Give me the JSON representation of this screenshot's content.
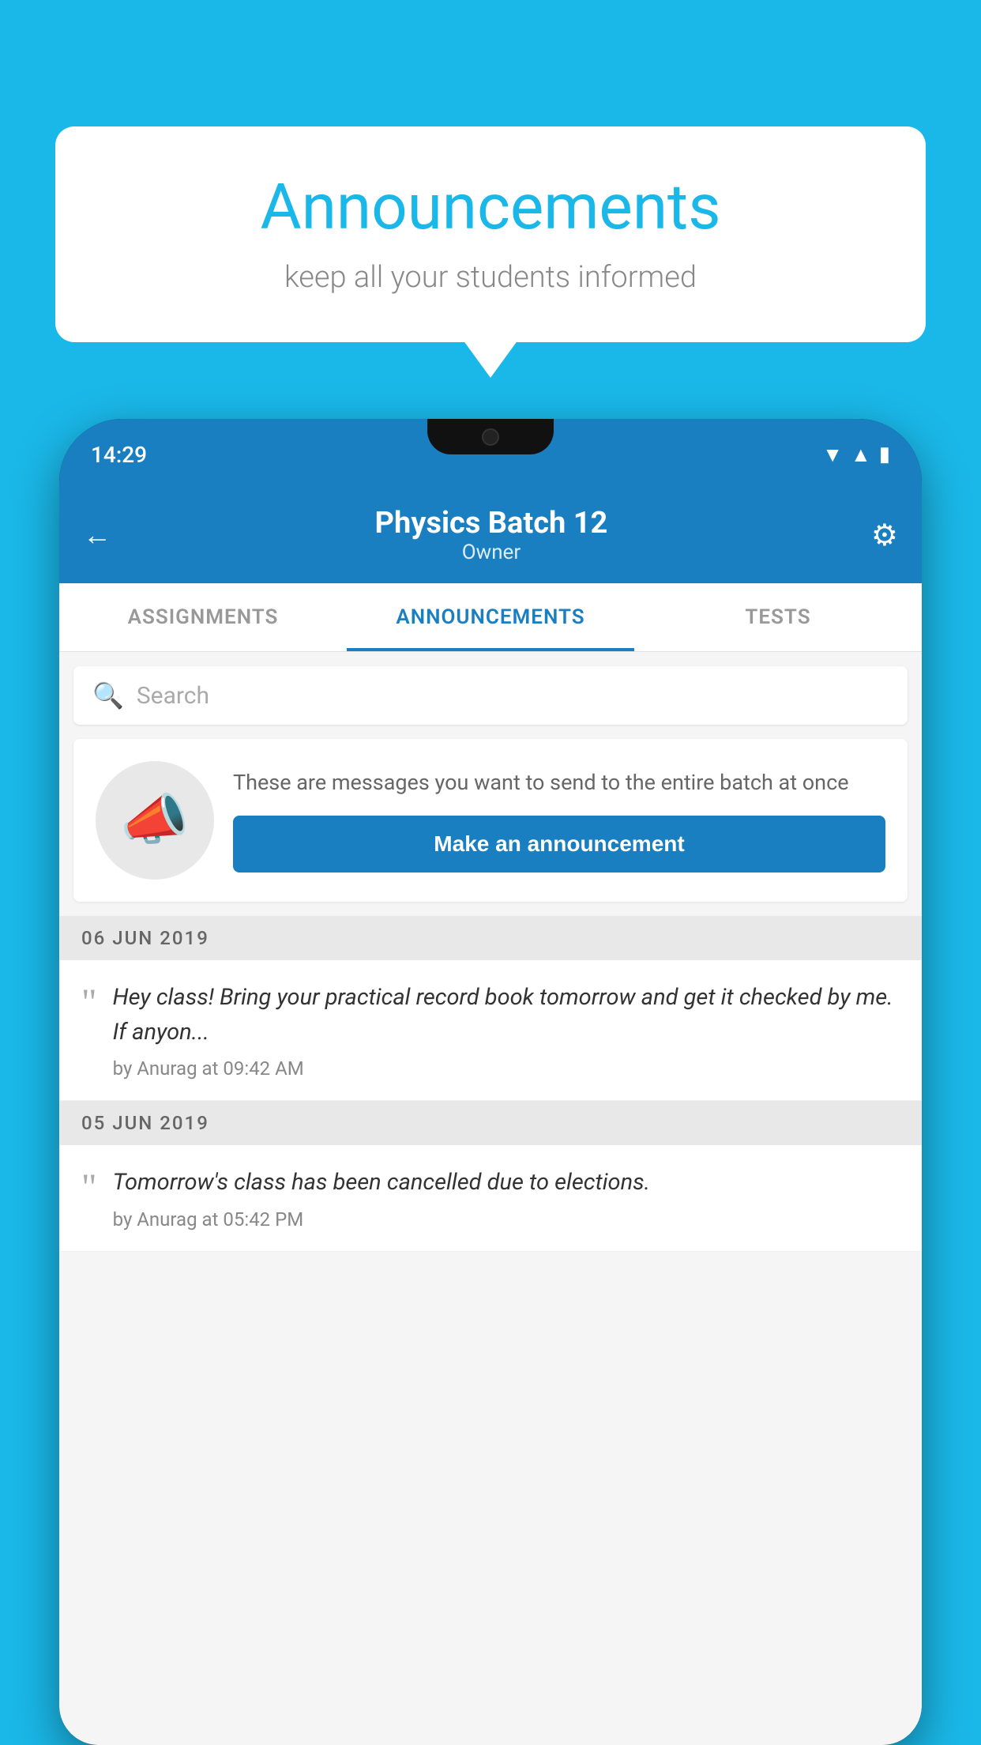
{
  "background_color": "#1ab8e8",
  "speech_bubble": {
    "title": "Announcements",
    "subtitle": "keep all your students informed"
  },
  "status_bar": {
    "time": "14:29",
    "icons": [
      "wifi",
      "signal",
      "battery"
    ]
  },
  "header": {
    "title": "Physics Batch 12",
    "subtitle": "Owner",
    "back_label": "←",
    "gear_label": "⚙"
  },
  "tabs": [
    {
      "label": "ASSIGNMENTS",
      "active": false
    },
    {
      "label": "ANNOUNCEMENTS",
      "active": true
    },
    {
      "label": "TESTS",
      "active": false
    }
  ],
  "search": {
    "placeholder": "Search"
  },
  "promo_card": {
    "description": "These are messages you want to send to the entire batch at once",
    "button_label": "Make an announcement"
  },
  "announcements": [
    {
      "date": "06  JUN  2019",
      "text": "Hey class! Bring your practical record book tomorrow and get it checked by me. If anyon...",
      "meta": "by Anurag at 09:42 AM"
    },
    {
      "date": "05  JUN  2019",
      "text": "Tomorrow's class has been cancelled due to elections.",
      "meta": "by Anurag at 05:42 PM"
    }
  ]
}
